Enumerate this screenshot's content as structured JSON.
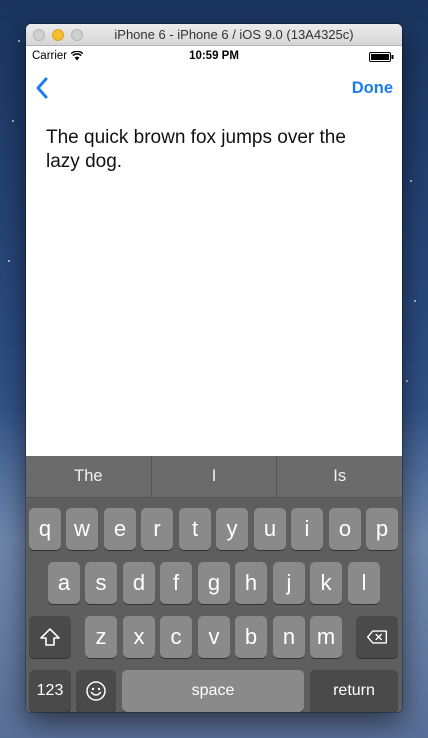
{
  "window": {
    "title": "iPhone 6 - iPhone 6 / iOS 9.0 (13A4325c)"
  },
  "status_bar": {
    "carrier": "Carrier",
    "time": "10:59 PM"
  },
  "nav_bar": {
    "back_icon": "chevron-left-icon",
    "done_label": "Done"
  },
  "text_view": {
    "text": "The quick brown fox jumps over the lazy dog."
  },
  "keyboard": {
    "suggestions": [
      "The",
      "I",
      "Is"
    ],
    "row1": [
      "q",
      "w",
      "e",
      "r",
      "t",
      "y",
      "u",
      "i",
      "o",
      "p"
    ],
    "row2": [
      "a",
      "s",
      "d",
      "f",
      "g",
      "h",
      "j",
      "k",
      "l"
    ],
    "row3": [
      "z",
      "x",
      "c",
      "v",
      "b",
      "n",
      "m"
    ],
    "numbers_label": "123",
    "space_label": "space",
    "return_label": "return"
  },
  "colors": {
    "accent": "#1a7ef2",
    "keyboard_bg": "#5e5e5e",
    "key_bg": "#8a8a8a"
  }
}
